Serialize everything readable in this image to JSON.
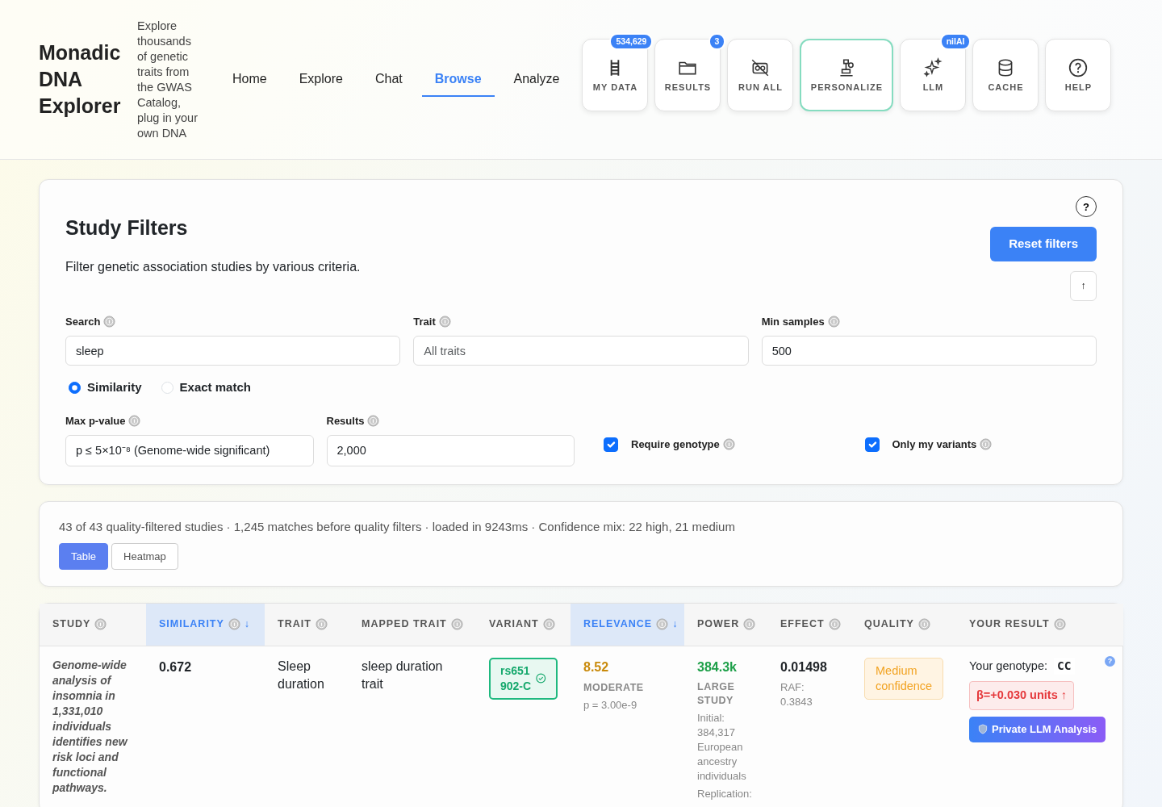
{
  "app": {
    "title": "Monadic DNA Explorer",
    "tagline": "Explore thousands of genetic traits from the GWAS Catalog, plug in your own DNA"
  },
  "nav": [
    {
      "label": "Home",
      "selected": false
    },
    {
      "label": "Explore",
      "selected": false
    },
    {
      "label": "Chat",
      "selected": false
    },
    {
      "label": "Browse",
      "selected": true
    },
    {
      "label": "Analyze",
      "selected": false
    }
  ],
  "toolbar": [
    {
      "label": "MY DATA",
      "badge": "534,629",
      "highlighted": false
    },
    {
      "label": "RESULTS",
      "badge": "3",
      "highlighted": false
    },
    {
      "label": "RUN ALL",
      "highlighted": false
    },
    {
      "label": "PERSONALIZE",
      "highlighted": true
    },
    {
      "label": "LLM",
      "badge": "nilAI",
      "highlighted": false
    },
    {
      "label": "CACHE",
      "highlighted": false
    },
    {
      "label": "HELP",
      "highlighted": false
    }
  ],
  "filters": {
    "title": "Study Filters",
    "description": "Filter genetic association studies by various criteria.",
    "help": "?",
    "reset_button": "Reset filters",
    "scroll_button": "↑",
    "search": {
      "label": "Search",
      "value": "sleep"
    },
    "trait": {
      "label": "Trait",
      "placeholder": "All traits"
    },
    "min_samples": {
      "label": "Min samples",
      "value": "500"
    },
    "match_modes": [
      {
        "label": "Similarity",
        "selected": true
      },
      {
        "label": "Exact match",
        "selected": false
      }
    ],
    "max_pvalue": {
      "label": "Max p-value",
      "value": "p ≤ 5×10⁻⁸ (Genome-wide significant)"
    },
    "results": {
      "label": "Results",
      "value": "2,000"
    },
    "checks": [
      {
        "label": "Require genotype",
        "checked": true
      },
      {
        "label": "Only my variants",
        "checked": true
      }
    ]
  },
  "summary": {
    "text": "43 of 43 quality-filtered studies · 1,245 matches before quality filters · loaded in 9243ms · Confidence mix: 22 high, 21 medium",
    "views": [
      {
        "label": "Table",
        "selected": true
      },
      {
        "label": "Heatmap",
        "selected": false
      }
    ]
  },
  "table": {
    "columns": [
      {
        "label": "STUDY",
        "sorted": false
      },
      {
        "label": "SIMILARITY",
        "sorted": true,
        "sort_arrow": "↓"
      },
      {
        "label": "TRAIT",
        "sorted": false
      },
      {
        "label": "MAPPED TRAIT",
        "sorted": false
      },
      {
        "label": "VARIANT",
        "sorted": false
      },
      {
        "label": "RELEVANCE",
        "sorted": true,
        "sort_arrow": "↓"
      },
      {
        "label": "POWER",
        "sorted": false
      },
      {
        "label": "EFFECT",
        "sorted": false
      },
      {
        "label": "QUALITY",
        "sorted": false
      },
      {
        "label": "YOUR RESULT",
        "sorted": false
      }
    ],
    "rows": [
      {
        "study": "Genome-wide analysis of insomnia in 1,331,010 individuals identifies new risk loci and functional pathways.",
        "similarity": "0.672",
        "trait": "Sleep duration",
        "mapped_trait": "sleep duration trait",
        "variant": {
          "text": "rs651902-C",
          "verified": true
        },
        "relevance": {
          "value": "8.52",
          "label": "MODERATE",
          "p": "p = 3.00e-9"
        },
        "power": {
          "value": "384.3k",
          "label": "LARGE STUDY",
          "details": [
            "Initial: 384,317 European ancestry individuals",
            "Replication:"
          ]
        },
        "effect": {
          "value": "0.01498",
          "raf": "RAF: 0.3843"
        },
        "quality": "Medium confidence",
        "your_result": {
          "genotype_label": "Your genotype:",
          "genotype": "CC",
          "effect": "β=+0.030 units ↑",
          "button": "Private LLM Analysis",
          "help": "?"
        }
      }
    ]
  }
}
